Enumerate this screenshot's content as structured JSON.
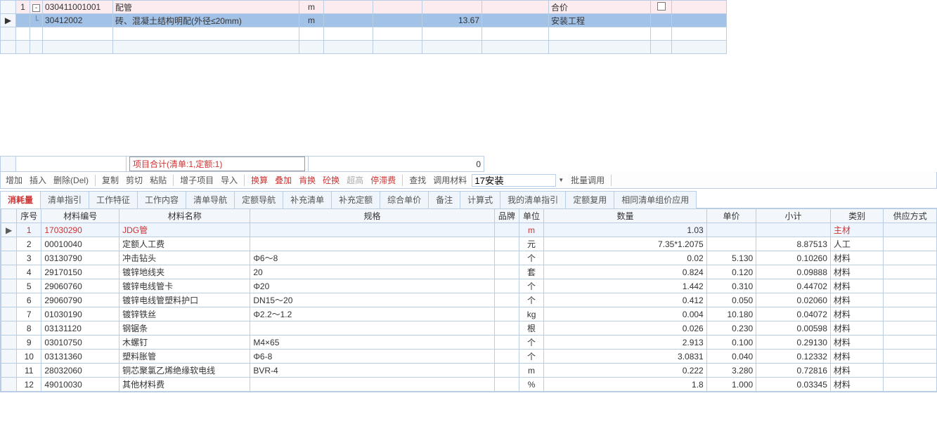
{
  "top": {
    "rows": [
      {
        "ptr": "",
        "seq": "1",
        "exp": "-",
        "code": "030411001001",
        "name": "配管",
        "unit": "m",
        "qty": "",
        "type": "合价",
        "chk": true,
        "css": "row-pink"
      },
      {
        "ptr": "▶",
        "seq": "",
        "exp": "L",
        "code": "30412002",
        "name": "砖、混凝土结构明配(外径≤20mm)",
        "unit": "m",
        "qty": "13.67",
        "type": "安装工程",
        "chk": false,
        "css": "row-sel"
      },
      {
        "css": "row-empty"
      },
      {
        "css": "row-empty2"
      }
    ]
  },
  "summary": {
    "label": "项目合计(清单:1,定额:1)",
    "value": "0"
  },
  "toolbar": {
    "items": [
      "增加",
      "插入",
      "删除(Del)",
      "|",
      "复制",
      "剪切",
      "粘贴",
      "|",
      "增子项目",
      "导入",
      "|",
      "换算",
      "叠加",
      "肯换",
      "砼换",
      "超高",
      "停滞费",
      "|",
      "查找",
      "调用材料"
    ],
    "red": [
      "换算",
      "叠加",
      "肯换",
      "砼换",
      "停滞费"
    ],
    "grey": [
      "超高"
    ],
    "matInput": "17安装",
    "batch": "批量调用"
  },
  "tabs": [
    "消耗量",
    "清单指引",
    "工作特征",
    "工作内容",
    "清单导航",
    "定额导航",
    "补充清单",
    "补充定额",
    "综合单价",
    "备注",
    "计算式",
    "我的清单指引",
    "定额复用",
    "相同清单组价应用"
  ],
  "activeTab": 0,
  "bottom": {
    "headers": [
      "序号",
      "材料编号",
      "材料名称",
      "规格",
      "品牌",
      "单位",
      "数量",
      "单价",
      "小计",
      "类别",
      "供应方式"
    ],
    "rows": [
      {
        "ptr": "▶",
        "sel": true,
        "seq": "1",
        "code": "17030290",
        "name": "JDG管",
        "spec": "",
        "unit": "m",
        "qty": "1.03",
        "price": "",
        "sub": "",
        "cat": "主材"
      },
      {
        "seq": "2",
        "code": "00010040",
        "name": "定额人工费",
        "spec": "",
        "unit": "元",
        "qty": "7.35*1.2075",
        "price": "",
        "sub": "8.87513",
        "cat": "人工"
      },
      {
        "seq": "3",
        "code": "03130790",
        "name": "冲击钻头",
        "spec": "Φ6～8",
        "unit": "个",
        "qty": "0.02",
        "price": "5.130",
        "sub": "0.10260",
        "cat": "材料"
      },
      {
        "seq": "4",
        "code": "29170150",
        "name": "镀锌地线夹",
        "spec": "20",
        "unit": "套",
        "qty": "0.824",
        "price": "0.120",
        "sub": "0.09888",
        "cat": "材料"
      },
      {
        "seq": "5",
        "code": "29060760",
        "name": "镀锌电线管卡",
        "spec": "Φ20",
        "unit": "个",
        "qty": "1.442",
        "price": "0.310",
        "sub": "0.44702",
        "cat": "材料"
      },
      {
        "seq": "6",
        "code": "29060790",
        "name": "镀锌电线管塑料护口",
        "spec": "DN15～20",
        "unit": "个",
        "qty": "0.412",
        "price": "0.050",
        "sub": "0.02060",
        "cat": "材料"
      },
      {
        "seq": "7",
        "code": "01030190",
        "name": "镀锌铁丝",
        "spec": "Φ2.2～1.2",
        "unit": "kg",
        "qty": "0.004",
        "price": "10.180",
        "sub": "0.04072",
        "cat": "材料"
      },
      {
        "seq": "8",
        "code": "03131120",
        "name": "钢锯条",
        "spec": "",
        "unit": "根",
        "qty": "0.026",
        "price": "0.230",
        "sub": "0.00598",
        "cat": "材料"
      },
      {
        "seq": "9",
        "code": "03010750",
        "name": "木螺钉",
        "spec": "M4×65",
        "unit": "个",
        "qty": "2.913",
        "price": "0.100",
        "sub": "0.29130",
        "cat": "材料"
      },
      {
        "seq": "10",
        "code": "03131360",
        "name": "塑料胀管",
        "spec": "Φ6-8",
        "unit": "个",
        "qty": "3.0831",
        "price": "0.040",
        "sub": "0.12332",
        "cat": "材料"
      },
      {
        "seq": "11",
        "code": "28032060",
        "name": "铜芯聚氯乙烯绝缘软电线",
        "spec": "BVR-4",
        "unit": "m",
        "qty": "0.222",
        "price": "3.280",
        "sub": "0.72816",
        "cat": "材料"
      },
      {
        "seq": "12",
        "code": "49010030",
        "name": "其他材料费",
        "spec": "",
        "unit": "%",
        "qty": "1.8",
        "price": "1.000",
        "sub": "0.03345",
        "cat": "材料"
      }
    ]
  }
}
